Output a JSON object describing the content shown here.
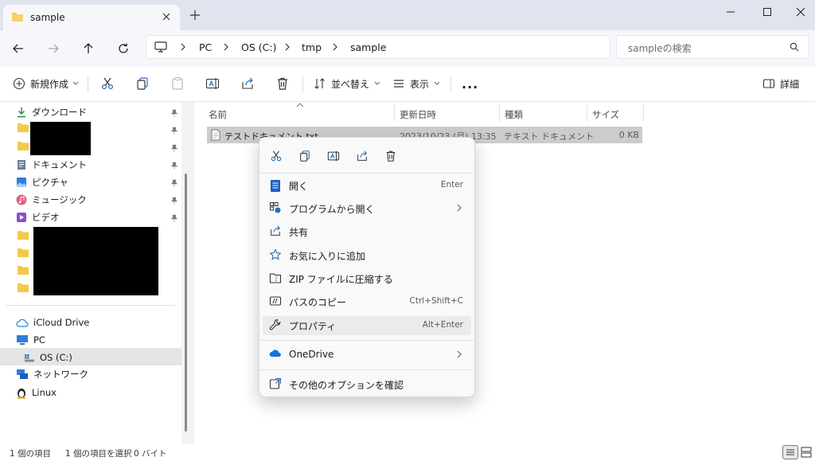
{
  "tab": {
    "title": "sample",
    "close_icon": "close-icon",
    "new_tab_icon": "plus-icon"
  },
  "window_controls": [
    "minimize-icon",
    "maximize-icon",
    "close-icon"
  ],
  "address": {
    "crumbs": [
      "PC",
      "OS (C:)",
      "tmp",
      "sample"
    ],
    "search_placeholder": "sampleの検索"
  },
  "toolbar": {
    "new_label": "新規作成",
    "sort_label": "並べ替え",
    "view_label": "表示",
    "more_label": "...",
    "details_label": "詳細"
  },
  "nav": {
    "items": [
      {
        "label": "ダウンロード",
        "icon": "download-icon",
        "pinned": true
      },
      {
        "label": "ドキュメント",
        "icon": "document-icon",
        "pinned": true
      },
      {
        "label": "ピクチャ",
        "icon": "pictures-icon",
        "pinned": true
      },
      {
        "label": "ミュージック",
        "icon": "music-icon",
        "pinned": true
      },
      {
        "label": "ビデオ",
        "icon": "video-icon",
        "pinned": true
      }
    ],
    "drives": [
      {
        "label": "iCloud Drive",
        "icon": "cloud-icon"
      },
      {
        "label": "PC",
        "icon": "computer-icon"
      },
      {
        "label": "OS (C:)",
        "icon": "drive-icon",
        "selected": true
      },
      {
        "label": "ネットワーク",
        "icon": "network-icon"
      },
      {
        "label": "Linux",
        "icon": "linux-icon"
      }
    ]
  },
  "columns": {
    "name": "名前",
    "date": "更新日時",
    "type": "種類",
    "size": "サイズ"
  },
  "files": [
    {
      "name": "テストドキュメント.txt",
      "date": "2023/10/23 (月) 13:35",
      "type": "テキスト ドキュメント",
      "size": "0 KB"
    }
  ],
  "context_menu": {
    "quick_actions": [
      "cut-icon",
      "copy-icon",
      "rename-icon",
      "share-icon",
      "delete-icon"
    ],
    "items": [
      {
        "label": "開く",
        "shortcut": "Enter",
        "icon": "notepad-icon"
      },
      {
        "label": "プログラムから開く",
        "shortcut": "",
        "icon": "open-with-icon",
        "submenu": true
      },
      {
        "label": "共有",
        "shortcut": "",
        "icon": "share-icon"
      },
      {
        "label": "お気に入りに追加",
        "shortcut": "",
        "icon": "star-icon"
      },
      {
        "label": "ZIP ファイルに圧縮する",
        "shortcut": "",
        "icon": "zip-icon"
      },
      {
        "label": "パスのコピー",
        "shortcut": "Ctrl+Shift+C",
        "icon": "copy-path-icon"
      },
      {
        "label": "プロパティ",
        "shortcut": "Alt+Enter",
        "icon": "wrench-icon"
      }
    ],
    "onedrive_label": "OneDrive",
    "more_options_label": "その他のオプションを確認"
  },
  "status": {
    "items_count": "1 個の項目",
    "selection": "1 個の項目を選択",
    "size": "0 バイト"
  }
}
